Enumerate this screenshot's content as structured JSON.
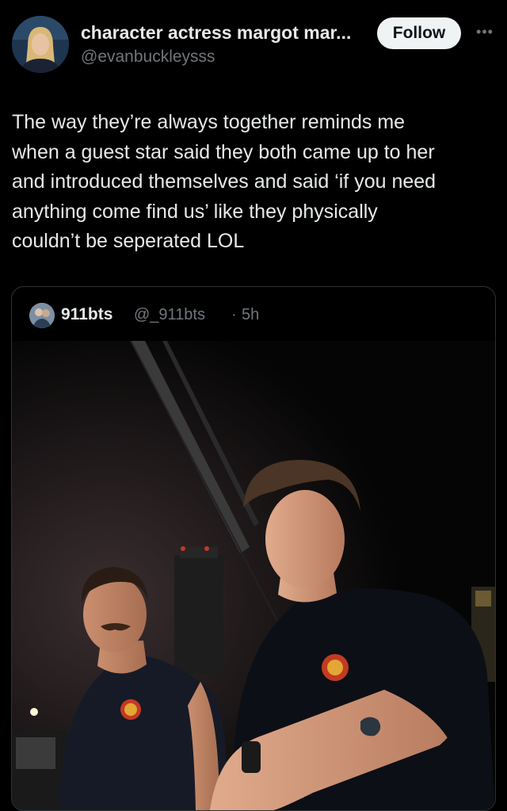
{
  "header": {
    "display_name": "character actress margot mar...",
    "handle": "@evanbuckleysss",
    "follow_label": "Follow",
    "more_icon": "more-horizontal-icon"
  },
  "tweet": {
    "lines": [
      "The way they’re always together reminds me",
      "when a guest star said they both came up to her",
      "and introduced themselves and said ‘if you need",
      "anything come find us’ like they physically",
      "couldn’t be seperated LOL"
    ]
  },
  "quote": {
    "name": "911bts",
    "handle": "@_911bts",
    "separator": "·",
    "time": "5h"
  },
  "colors": {
    "background": "#000000",
    "text": "#e7e9ea",
    "muted": "#71767b",
    "border": "#2f3336",
    "follow_bg": "#eff3f4"
  }
}
